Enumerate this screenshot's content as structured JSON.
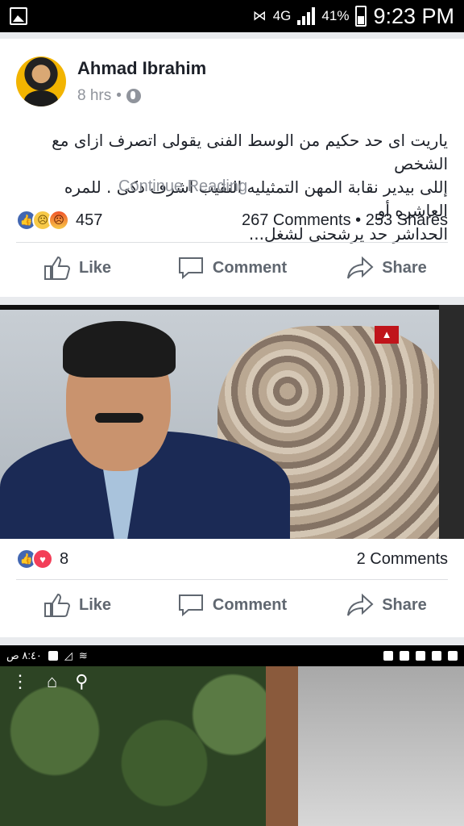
{
  "status_bar": {
    "network": "4G",
    "battery_percent": "41%",
    "time": "9:23 PM"
  },
  "post1": {
    "author": "Ahmad Ibrahim",
    "timestamp": "8 hrs",
    "text_lines": [
      "ياريت اى حد حكيم من الوسط الفنى يقولى اتصرف ازاى مع الشخص",
      "إللى بيدير نقابة المهن التمثيليه النقيب اشرف ذكى . للمره العاشره أو",
      "الحداشر حد يرشحنى لشغل..."
    ],
    "continue_label": "Continue Reading",
    "reaction_count": "457",
    "comments": "267 Comments",
    "shares": "253 Shares"
  },
  "post2": {
    "reaction_count": "8",
    "comments": "2 Comments"
  },
  "actions": {
    "like": "Like",
    "comment": "Comment",
    "share": "Share"
  },
  "post3": {
    "status_time": "٨:٤٠ ص"
  },
  "colors": {
    "like_blue": "#4267b2",
    "text_gray": "#90949c",
    "action_gray": "#606770"
  }
}
